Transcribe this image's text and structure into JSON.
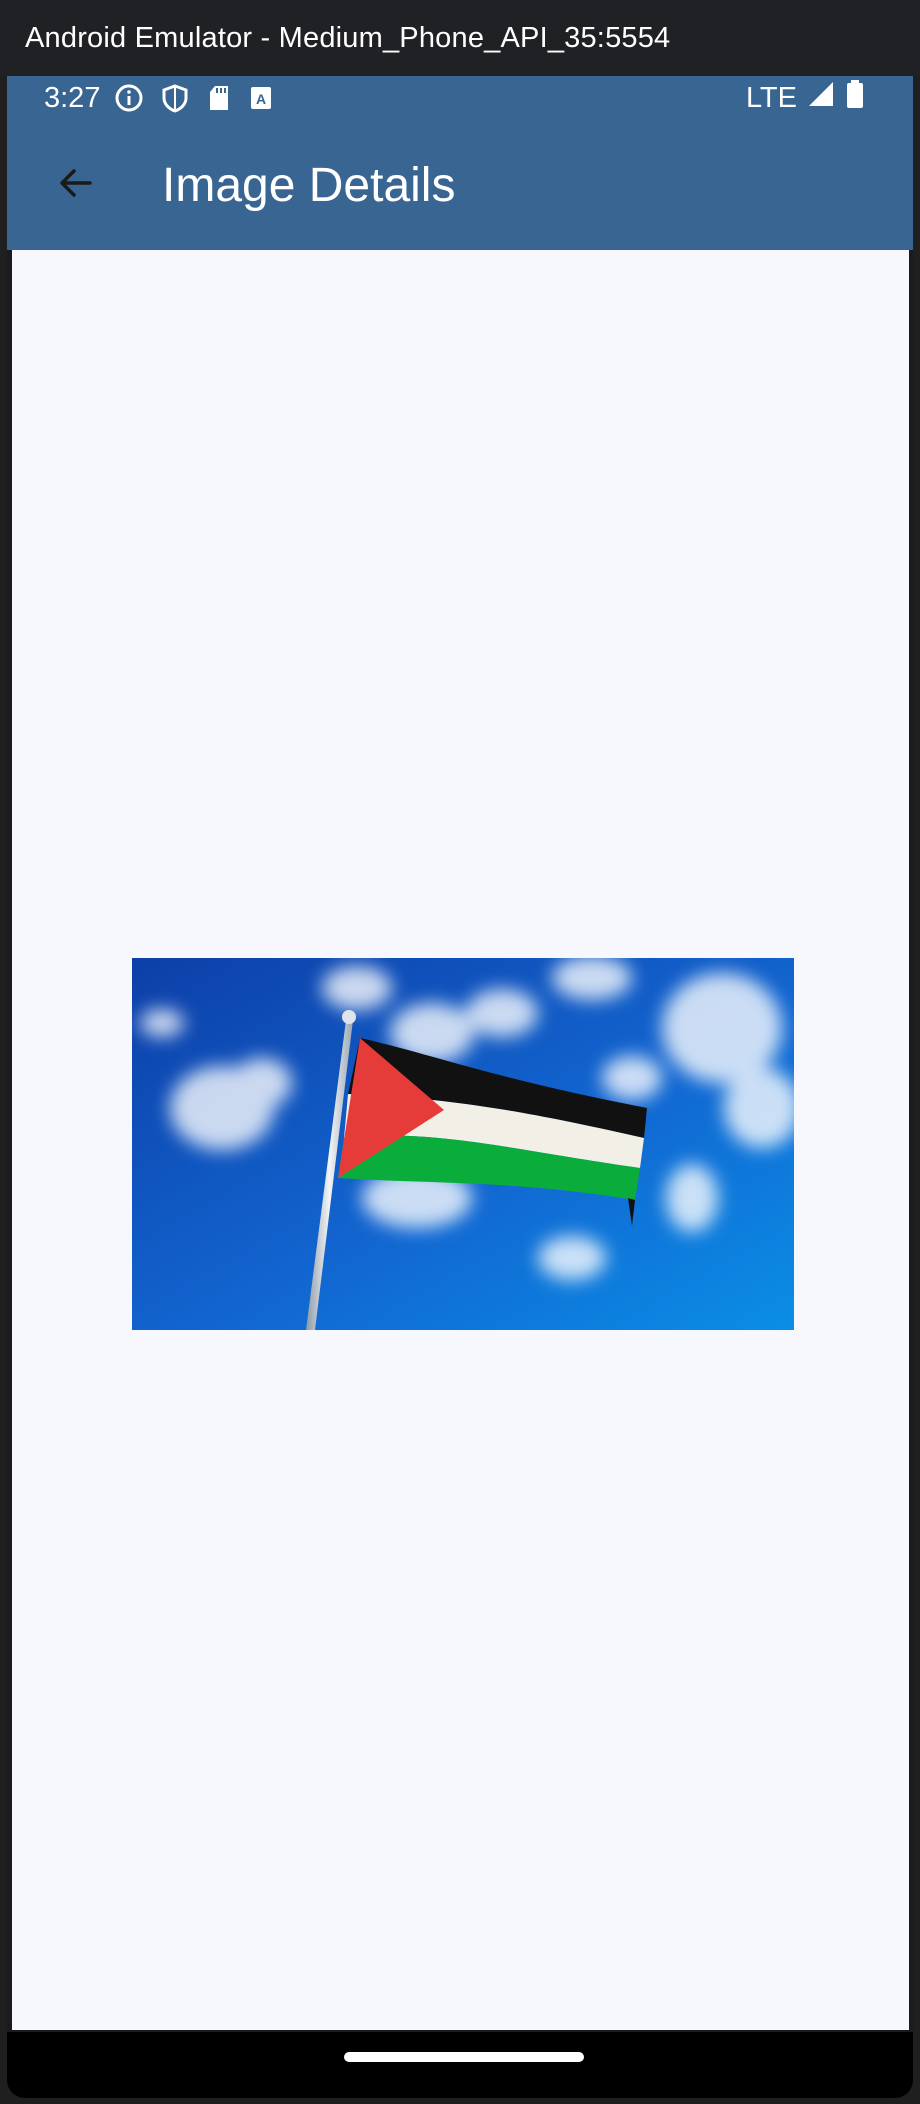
{
  "window": {
    "title": "Android Emulator - Medium_Phone_API_35:5554"
  },
  "status_bar": {
    "time": "3:27",
    "left_icons": [
      "info-icon",
      "shield-icon",
      "sd-card-icon",
      "keyboard-a-icon"
    ],
    "network": "LTE",
    "right_icons": [
      "signal-icon",
      "battery-icon"
    ]
  },
  "app_bar": {
    "title": "Image Details",
    "back_icon": "arrow-back-icon",
    "color": "#386592"
  },
  "content": {
    "background": "#f7f8fd",
    "image": {
      "subject": "palestinian-flag-on-pole-against-blue-sky"
    }
  }
}
